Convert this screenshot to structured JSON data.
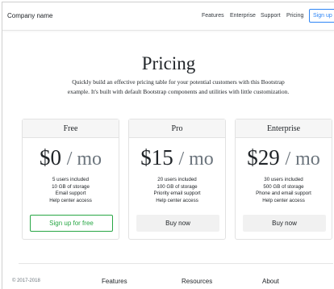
{
  "navbar": {
    "brand": "Company name",
    "links": [
      "Features",
      "Enterprise",
      "Support",
      "Pricing"
    ],
    "signup_label": "Sign up"
  },
  "hero": {
    "title": "Pricing",
    "lead": "Quickly build an effective pricing table for your potential customers with this Bootstrap example. It's built with default Bootstrap components and utilities with little customization."
  },
  "plans": [
    {
      "name": "Free",
      "price": "$0",
      "unit": "/ mo",
      "features": [
        "5 users included",
        "10 GB of storage",
        "Email support",
        "Help center access"
      ],
      "button": "Sign up for free"
    },
    {
      "name": "Pro",
      "price": "$15",
      "unit": "/ mo",
      "features": [
        "20 users included",
        "100 GB of storage",
        "Priority email support",
        "Help center access"
      ],
      "button": "Buy now"
    },
    {
      "name": "Enterprise",
      "price": "$29",
      "unit": "/ mo",
      "features": [
        "30 users included",
        "500 GB of storage",
        "Phone and email support",
        "Help center access"
      ],
      "button": "Buy now"
    }
  ],
  "footer": {
    "copyright": "© 2017-2018",
    "headings": [
      "Features",
      "Resources",
      "About"
    ]
  },
  "colors": {
    "accent_blue": "#2f86f6",
    "success_green": "#28a745",
    "card_header_bg": "#f6f6f6"
  }
}
